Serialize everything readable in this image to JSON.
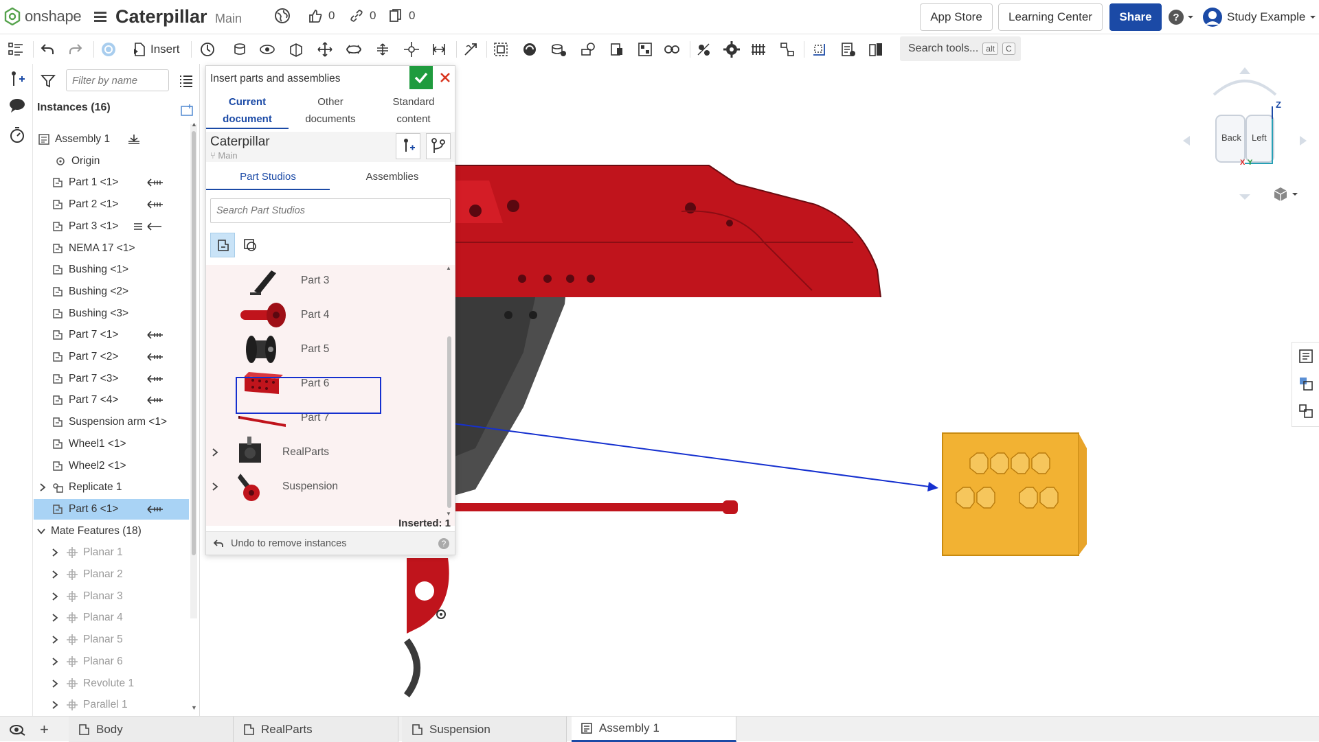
{
  "app": {
    "brand": "onshape",
    "document_title": "Caterpillar",
    "branch": "Main"
  },
  "header": {
    "likes": "0",
    "links": "0",
    "copies": "0",
    "app_store_label": "App Store",
    "learning_center_label": "Learning Center",
    "share_label": "Share",
    "user_name": "Study Example"
  },
  "toolbar": {
    "insert_label": "Insert",
    "search_placeholder": "Search tools...",
    "search_shortcut_1": "alt",
    "search_shortcut_2": "C"
  },
  "tree": {
    "filter_placeholder": "Filter by name",
    "instances_header": "Instances (16)",
    "items": [
      {
        "label": "Assembly 1",
        "kind": "assembly"
      },
      {
        "label": "Origin",
        "kind": "origin"
      },
      {
        "label": "Part 1 <1>",
        "kind": "part"
      },
      {
        "label": "Part 2 <1>",
        "kind": "part"
      },
      {
        "label": "Part 3 <1>",
        "kind": "part"
      },
      {
        "label": "NEMA 17 <1>",
        "kind": "part"
      },
      {
        "label": "Bushing <1>",
        "kind": "part"
      },
      {
        "label": "Bushing <2>",
        "kind": "part"
      },
      {
        "label": "Bushing <3>",
        "kind": "part"
      },
      {
        "label": "Part 7 <1>",
        "kind": "part"
      },
      {
        "label": "Part 7 <2>",
        "kind": "part"
      },
      {
        "label": "Part 7 <3>",
        "kind": "part"
      },
      {
        "label": "Part 7 <4>",
        "kind": "part"
      },
      {
        "label": "Suspension arm <1>",
        "kind": "part"
      },
      {
        "label": "Wheel1 <1>",
        "kind": "part"
      },
      {
        "label": "Wheel2 <1>",
        "kind": "part"
      },
      {
        "label": "Replicate 1",
        "kind": "replicate"
      },
      {
        "label": "Part 6 <1>",
        "kind": "part",
        "selected": true
      }
    ],
    "mate_features_header": "Mate Features (18)",
    "mates": [
      "Planar 1",
      "Planar 2",
      "Planar 3",
      "Planar 4",
      "Planar 5",
      "Planar 6",
      "Revolute 1",
      "Parallel 1"
    ]
  },
  "dialog": {
    "title": "Insert parts and assemblies",
    "tabs": [
      {
        "line1": "Current",
        "line2": "document"
      },
      {
        "line1": "Other",
        "line2": "documents"
      },
      {
        "line1": "Standard",
        "line2": "content"
      }
    ],
    "doc_name": "Caterpillar",
    "doc_branch": "Main",
    "sub_tabs": [
      "Part Studios",
      "Assemblies"
    ],
    "search_placeholder": "Search Part Studios",
    "items": [
      "Part 3",
      "Part 4",
      "Part 5",
      "Part 6",
      "Part 7",
      "RealParts",
      "Suspension"
    ],
    "inserted_label": "Inserted: 1",
    "undo_label": "Undo to remove instances"
  },
  "viewcube": {
    "back_label": "Back",
    "left_label": "Left",
    "axis_z": "Z",
    "axis_x": "X",
    "axis_y": "Y"
  },
  "bottom_tabs": [
    "Body",
    "RealParts",
    "Suspension",
    "Assembly 1"
  ],
  "colors": {
    "accent": "#1b4aa6",
    "selection": "#a9d3f5",
    "part_red": "#c0141c",
    "highlight_orange": "#f2b233",
    "ok_green": "#1f9b3e"
  }
}
